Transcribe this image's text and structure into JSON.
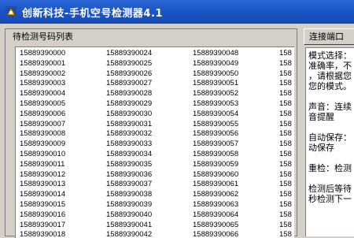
{
  "window": {
    "title": "创新科技-手机空号检测器4.1",
    "icon": "app-logo-icon"
  },
  "list_panel": {
    "title": "待检测号码列表",
    "numbers": [
      "15889390000",
      "15889390001",
      "15889390002",
      "15889390003",
      "15889390004",
      "15889390005",
      "15889390006",
      "15889390007",
      "15889390008",
      "15889390009",
      "15889390010",
      "15889390011",
      "15889390012",
      "15889390013",
      "15889390014",
      "15889390015",
      "15889390016",
      "15889390017",
      "15889390018",
      "15889390024",
      "15889390025",
      "15889390026",
      "15889390027",
      "15889390028",
      "15889390029",
      "15889390030",
      "15889390031",
      "15889390032",
      "15889390033",
      "15889390034",
      "15889390035",
      "15889390036",
      "15889390037",
      "15889390038",
      "15889390039",
      "15889390040",
      "15889390041",
      "15889390042",
      "15889390048",
      "15889390049",
      "15889390050",
      "15889390051",
      "15889390052",
      "15889390053",
      "15889390054",
      "15889390055",
      "15889390056",
      "15889390057",
      "15889390058",
      "15889390059",
      "15889390060",
      "15889390061",
      "15889390062",
      "15889390063",
      "15889390064",
      "15889390065",
      "15889390066",
      "158",
      "158",
      "158",
      "158",
      "158",
      "158",
      "158",
      "158",
      "158",
      "158",
      "158",
      "158",
      "158",
      "158",
      "158",
      "158",
      "158",
      "158",
      "158"
    ]
  },
  "right_panel": {
    "port_button": "连接端口",
    "info_lines": [
      "模式选择：",
      "准确率，不",
      "，请根据您",
      "您的模式。",
      "",
      "声音：连续",
      "音提醒",
      "",
      "自动保存：",
      "动保存",
      "",
      "重检：检测",
      "",
      "检测后等待",
      "秒检测下一"
    ]
  },
  "colors": {
    "titlebar": "#1d56c5",
    "window_bg": "#d4d0c8",
    "list_bg": "#ffffff"
  }
}
